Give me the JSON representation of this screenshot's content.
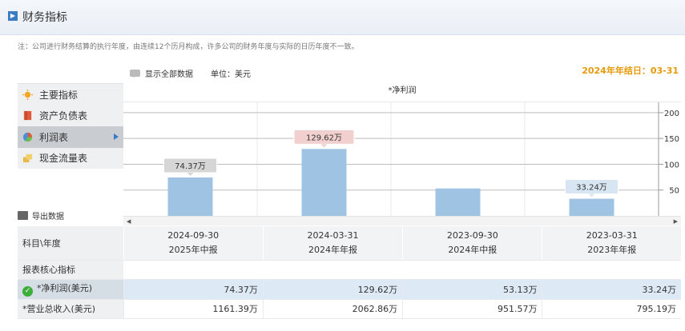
{
  "header": {
    "title": "财务指标"
  },
  "note": "注：公司进行财务结算的执行年度，由连续12个历月构成，许多公司的财务年度与实际的日历年度不一致。",
  "fiscal_year_end": "2024年年结日：03-31",
  "toolbar": {
    "show_all": "显示全部数据",
    "unit": "单位：美元"
  },
  "sidebar": {
    "items": [
      {
        "label": "主要指标",
        "icon": "sun-icon"
      },
      {
        "label": "资产负债表",
        "icon": "book-icon"
      },
      {
        "label": "利润表",
        "icon": "pie-icon"
      },
      {
        "label": "现金流量表",
        "icon": "coins-icon"
      }
    ],
    "active_index": 2
  },
  "export_label": "导出数据",
  "colors": {
    "bar": "#9fc4e3",
    "accent": "#e69a0a",
    "check": "#3bae3b",
    "highlight_row": "#dde9f5"
  },
  "chart_data": {
    "type": "bar",
    "title": "*净利润",
    "categories": [
      "2024-09-30",
      "2024-03-31",
      "2023-09-30",
      "2023-03-31"
    ],
    "values": [
      74.37,
      129.62,
      53.13,
      33.24
    ],
    "data_labels": [
      "74.37万",
      "129.62万",
      "",
      "33.24万"
    ],
    "y_ticks": [
      50,
      100,
      150,
      200
    ],
    "ylim": [
      0,
      220
    ],
    "grid": true
  },
  "table": {
    "corner": "科目\\年度",
    "columns": [
      {
        "date": "2024-09-30",
        "period": "2025年中报"
      },
      {
        "date": "2024-03-31",
        "period": "2024年年报"
      },
      {
        "date": "2023-09-30",
        "period": "2024年中报"
      },
      {
        "date": "2023-03-31",
        "period": "2023年年报"
      }
    ],
    "section": "报表核心指标",
    "rows": [
      {
        "label": "*净利润(美元)",
        "values": [
          "74.37万",
          "129.62万",
          "53.13万",
          "33.24万"
        ]
      },
      {
        "label": "*营业总收入(美元)",
        "values": [
          "1161.39万",
          "2062.86万",
          "951.57万",
          "795.19万"
        ]
      }
    ]
  }
}
